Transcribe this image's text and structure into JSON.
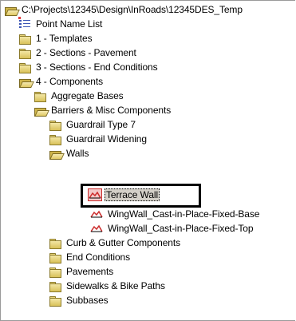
{
  "tree": {
    "root": {
      "label": "C:\\Projects\\12345\\Design\\InRoads\\12345DES_Temp"
    },
    "point_name_list": {
      "label": "Point Name List"
    },
    "templates": {
      "label": "1 - Templates"
    },
    "sections_pavement": {
      "label": "2 - Sections - Pavement"
    },
    "sections_end_conditions": {
      "label": "3 - Sections - End Conditions"
    },
    "components": {
      "label": "4 - Components"
    },
    "aggregate_bases": {
      "label": "Aggregate Bases"
    },
    "barriers": {
      "label": "Barriers & Misc Components"
    },
    "guardrail_type7": {
      "label": "Guardrail Type 7"
    },
    "guardrail_widening": {
      "label": "Guardrail Widening"
    },
    "walls": {
      "label": "Walls"
    },
    "terrace_wall": {
      "label": "Terrace Wall"
    },
    "wingwall_base": {
      "label": "WingWall_Cast-in-Place-Fixed-Base"
    },
    "wingwall_top": {
      "label": "WingWall_Cast-in-Place-Fixed-Top"
    },
    "curb_gutter": {
      "label": "Curb & Gutter Components"
    },
    "end_conditions": {
      "label": "End Conditions"
    },
    "pavements": {
      "label": "Pavements"
    },
    "sidewalks": {
      "label": "Sidewalks & Bike Paths"
    },
    "subbases": {
      "label": "Subbases"
    }
  },
  "icons": {
    "folder": "folder-icon",
    "folder_open": "folder-open-icon",
    "list": "list-icon",
    "wall_template": "wall-template-icon"
  },
  "colors": {
    "folder_fill": "#e8d478",
    "selection_frame": "#000000",
    "template_icon": "#cc2b2b"
  }
}
